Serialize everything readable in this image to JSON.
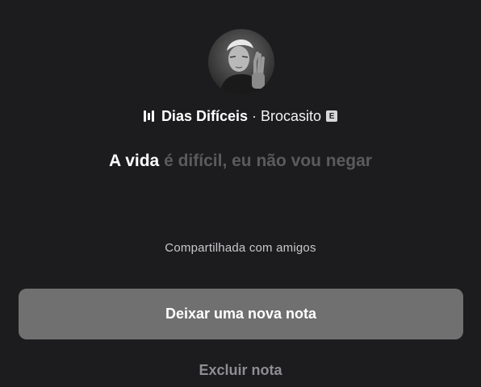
{
  "avatar": {
    "icon": "profile-photo"
  },
  "track": {
    "icon": "equalizer-bars-icon",
    "title": "Dias Difíceis",
    "separator": "·",
    "artist": "Brocasito",
    "explicit_badge": "E"
  },
  "lyric": {
    "active": "A vida",
    "dim": "é difícil, eu não vou negar"
  },
  "share_status": "Compartilhada com amigos",
  "actions": {
    "new_note_label": "Deixar uma nova nota",
    "delete_label": "Excluir nota"
  },
  "colors": {
    "background": "#1c1c1e",
    "button_fill": "#707070",
    "dim_text": "#5b5b5e",
    "secondary_text": "#8e8e93"
  }
}
